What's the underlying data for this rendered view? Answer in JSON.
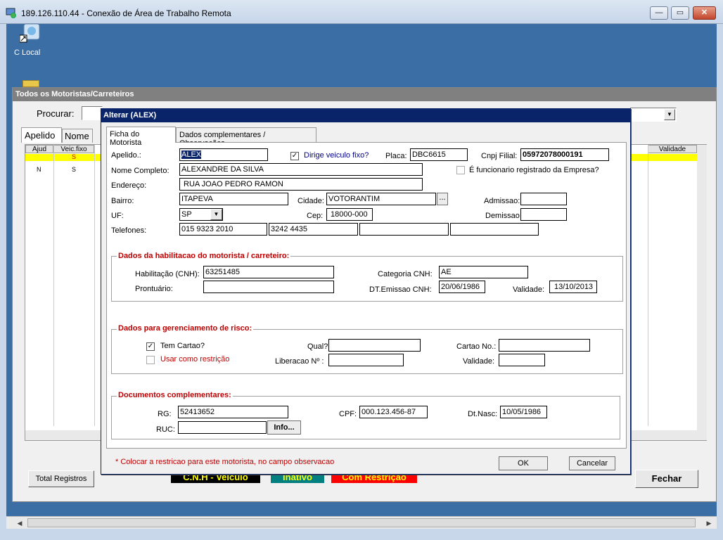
{
  "rdp": {
    "title": "189.126.110.44 - Conexão de Área de Trabalho Remota",
    "minimize": "—",
    "restore": "▭",
    "close": "✕"
  },
  "desktop": {
    "icon_label": "C Local"
  },
  "background_window": {
    "title": "Todos os Motoristas/Carreteiros",
    "search_label": "Procurar:",
    "tabs": [
      "Apelido",
      "Nome"
    ],
    "grid_headers": [
      "Ajud",
      "Veic.fixo",
      "Validade"
    ],
    "rows": [
      {
        "ajud": "",
        "veic": "S"
      },
      {
        "ajud": "N",
        "veic": "S"
      }
    ],
    "total_button": "Total Registros",
    "legend": [
      {
        "text": "C.N.H - Veiculo",
        "bg": "#000000",
        "fg": "#ffff00"
      },
      {
        "text": "Inativo",
        "bg": "#008080",
        "fg": "#ffff00"
      },
      {
        "text": "Com Restrição",
        "bg": "#ff0000",
        "fg": "#ffff00"
      }
    ],
    "close_button": "Fechar"
  },
  "dialog": {
    "title": "Alterar  (ALEX)",
    "tabs": [
      "Ficha do Motorista",
      "Dados complementares / Observações"
    ],
    "labels": {
      "apelido": "Apelido.:",
      "dirige": "Dirige veiculo fixo?",
      "placa": "Placa:",
      "cnpj": "Cnpj Filial:",
      "nome": "Nome Completo:",
      "funcionario": "É funcionario registrado da Empresa?",
      "endereco": "Endereço:",
      "bairro": "Bairro:",
      "cidade": "Cidade:",
      "admissao": "Admissao:",
      "uf": "UF:",
      "cep": "Cep:",
      "demissao": "Demissao",
      "telefones": "Telefones:"
    },
    "values": {
      "apelido": "ALEX",
      "placa": "DBC6615",
      "cnpj": "05972078000191",
      "nome": "ALEXANDRE DA SILVA",
      "endereco": "RUA JOAO PEDRO RAMON",
      "bairro": "ITAPEVA",
      "cidade": "VOTORANTIM",
      "admissao": "",
      "uf": "SP",
      "cep": "18000-000",
      "demissao": "",
      "tel1": "015 9323 2010",
      "tel2": "3242 4435",
      "tel3": "",
      "tel4": ""
    },
    "habilitacao": {
      "title": "Dados da habilitacao do motorista / carreteiro:",
      "cnh_label": "Habilitação (CNH):",
      "cnh": "63251485",
      "categoria_label": "Categoria CNH:",
      "categoria": "AE",
      "prontuario_label": "Prontuário:",
      "prontuario": "",
      "emissao_label": "DT.Emissao CNH:",
      "emissao": "20/06/1986",
      "validade_label": "Validade:",
      "validade": "13/10/2013"
    },
    "risco": {
      "title": "Dados para gerenciamento de risco:",
      "cartao_label": "Tem Cartao?",
      "restricao_label": "Usar como restrição",
      "qual_label": "Qual?",
      "qual": "",
      "liberacao_label": "Liberacao Nº :",
      "liberacao": "",
      "cartao_no_label": "Cartao No.:",
      "cartao_no": "",
      "validade_label": "Validade:",
      "validade": ""
    },
    "documentos": {
      "title": "Documentos complementares:",
      "rg_label": "RG:",
      "rg": "52413652",
      "cpf_label": "CPF:",
      "cpf": "000.123.456-87",
      "nasc_label": "Dt.Nasc:",
      "nasc": "10/05/1986",
      "ruc_label": "RUC:",
      "ruc": "",
      "info_button": "Info..."
    },
    "note": "* Colocar a restricao para este motorista, no campo observacao",
    "ok": "OK",
    "cancel": "Cancelar",
    "ellipsis": "...",
    "check": "✓",
    "dropdown_arrow": "▼"
  }
}
